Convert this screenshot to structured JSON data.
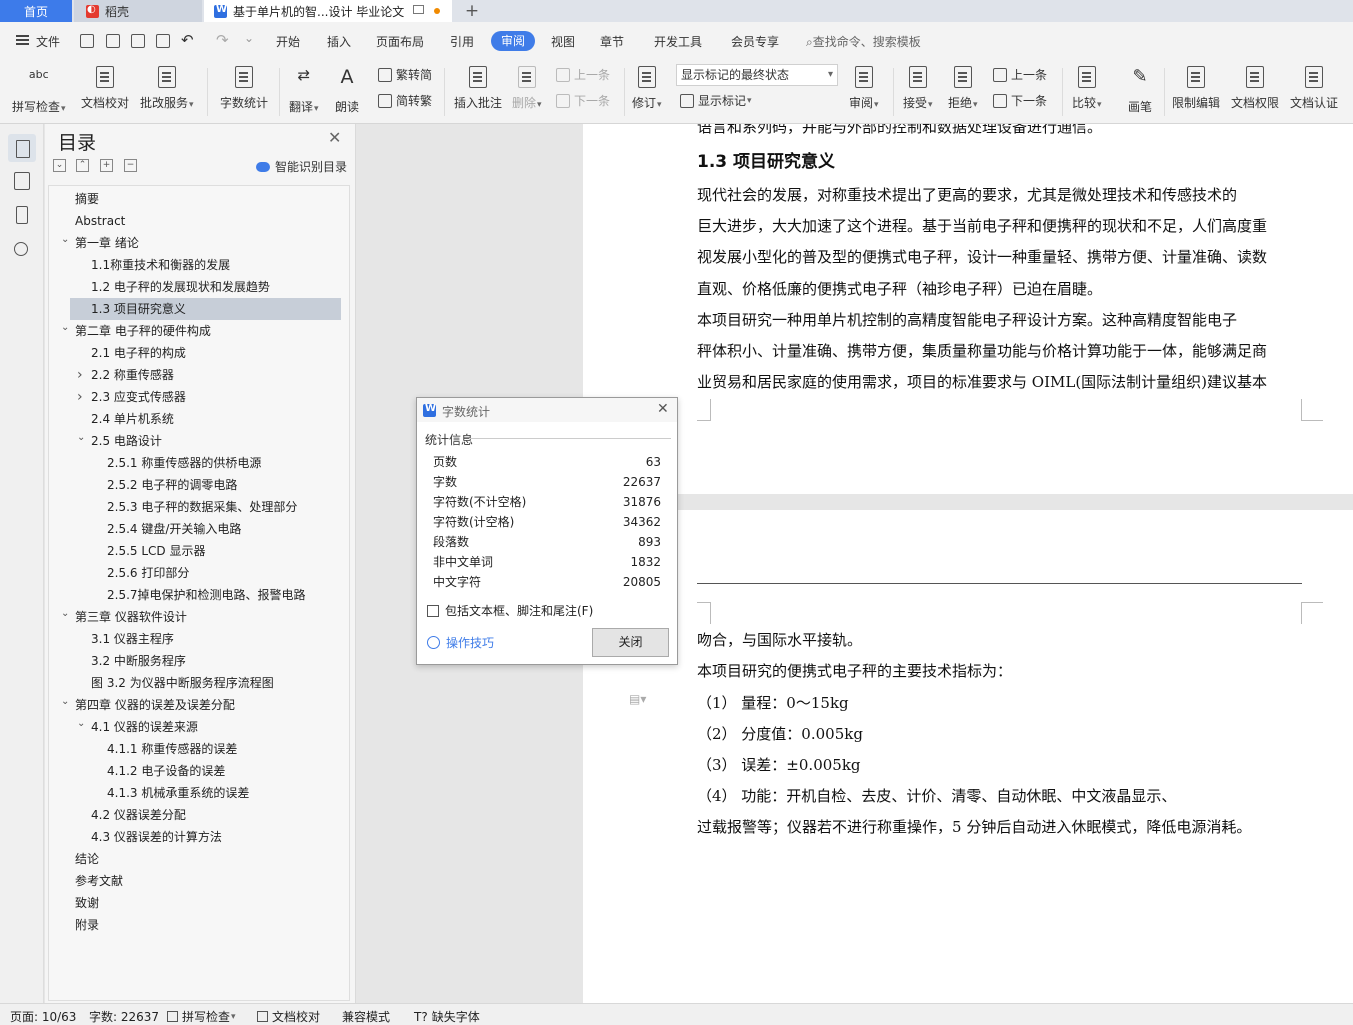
{
  "tabs": {
    "home": "首页",
    "daoke": "稻壳",
    "document": "基于单片机的智...设计 毕业论文"
  },
  "menu": {
    "file": "文件",
    "items": [
      "开始",
      "插入",
      "页面布局",
      "引用",
      "审阅",
      "视图",
      "章节",
      "开发工具",
      "会员专享"
    ],
    "search_placeholder": "查找命令、搜索模板"
  },
  "ribbon": {
    "spell_check": "拼写检查",
    "doc_proof": "文档校对",
    "annotate_service": "批改服务",
    "word_count": "字数统计",
    "translate": "翻译",
    "read_aloud": "朗读",
    "to_traditional": "繁转简",
    "to_simplified": "简转繁",
    "insert_comment": "插入批注",
    "delete": "删除",
    "prev_comment": "上一条",
    "next_comment": "下一条",
    "revise": "修订",
    "track_state": "显示标记的最终状态",
    "show_markup": "显示标记",
    "review": "审阅",
    "accept": "接受",
    "reject": "拒绝",
    "prev_change": "上一条",
    "next_change": "下一条",
    "compare": "比较",
    "pen": "画笔",
    "restrict_edit": "限制编辑",
    "doc_permission": "文档权限",
    "doc_cert": "文档认证"
  },
  "toc": {
    "title": "目录",
    "smart_toc": "智能识别目录",
    "items": [
      {
        "label": "摘要",
        "level": 1,
        "arrow": ""
      },
      {
        "label": "Abstract",
        "level": 1,
        "arrow": ""
      },
      {
        "label": "第一章  绪论",
        "level": 1,
        "arrow": "v"
      },
      {
        "label": "1.1称重技术和衡器的发展",
        "level": 2,
        "arrow": ""
      },
      {
        "label": "1.2 电子秤的发展现状和发展趋势",
        "level": 2,
        "arrow": ""
      },
      {
        "label": "1.3 项目研究意义",
        "level": 2,
        "arrow": "",
        "selected": true
      },
      {
        "label": "第二章    电子秤的硬件构成",
        "level": 1,
        "arrow": "v"
      },
      {
        "label": "2.1      电子秤的构成",
        "level": 2,
        "arrow": ""
      },
      {
        "label": "2.2    称重传感器",
        "level": 2,
        "arrow": ">"
      },
      {
        "label": "2.3    应变式传感器",
        "level": 2,
        "arrow": ">"
      },
      {
        "label": "2.4    单片机系统",
        "level": 2,
        "arrow": ""
      },
      {
        "label": "2.5    电路设计",
        "level": 2,
        "arrow": "v"
      },
      {
        "label": "2.5.1    称重传感器的供桥电源",
        "level": 3,
        "arrow": ""
      },
      {
        "label": "2.5.2    电子秤的调零电路",
        "level": 3,
        "arrow": ""
      },
      {
        "label": "2.5.3    电子秤的数据采集、处理部分",
        "level": 3,
        "arrow": ""
      },
      {
        "label": "2.5.4  键盘/开关输入电路",
        "level": 3,
        "arrow": ""
      },
      {
        "label": "2.5.5    LCD 显示器",
        "level": 3,
        "arrow": ""
      },
      {
        "label": "2.5.6  打印部分",
        "level": 3,
        "arrow": ""
      },
      {
        "label": "2.5.7掉电保护和检测电路、报警电路",
        "level": 3,
        "arrow": ""
      },
      {
        "label": "第三章    仪器软件设计",
        "level": 1,
        "arrow": "v"
      },
      {
        "label": "3.1  仪器主程序",
        "level": 2,
        "arrow": ""
      },
      {
        "label": "3.2  中断服务程序",
        "level": 2,
        "arrow": ""
      },
      {
        "label": "图 3.2 为仪器中断服务程序流程图",
        "level": 2,
        "arrow": ""
      },
      {
        "label": "第四章     仪器的误差及误差分配",
        "level": 1,
        "arrow": "v"
      },
      {
        "label": "4.1  仪器的误差来源",
        "level": 2,
        "arrow": "v"
      },
      {
        "label": "4.1.1  称重传感器的误差",
        "level": 3,
        "arrow": ""
      },
      {
        "label": "4.1.2    电子设备的误差",
        "level": 3,
        "arrow": ""
      },
      {
        "label": "4.1.3  机械承重系统的误差",
        "level": 3,
        "arrow": ""
      },
      {
        "label": "4.2    仪器误差分配",
        "level": 2,
        "arrow": ""
      },
      {
        "label": "4.3    仪器误差的计算方法",
        "level": 2,
        "arrow": ""
      },
      {
        "label": "结论",
        "level": 1,
        "arrow": ""
      },
      {
        "label": "参考文献",
        "level": 1,
        "arrow": ""
      },
      {
        "label": "致谢",
        "level": 1,
        "arrow": ""
      },
      {
        "label": "附录",
        "level": 1,
        "arrow": ""
      }
    ]
  },
  "document": {
    "cut_line": "语言和系列码，并能与外部的控制和数据处理设备进行通信。",
    "heading": "1.3 项目研究意义",
    "para1": [
      "        现代社会的发展，对称重技术提出了更高的要求，尤其是微处理技术和传感技术的",
      "巨大进步，大大加速了这个进程。基于当前电子秤和便携秤的现状和不足，人们高度重",
      "视发展小型化的普及型的便携式电子秤，设计一种重量轻、携带方便、计量准确、读数",
      "直观、价格低廉的便携式电子秤（袖珍电子秤）已迫在眉睫。"
    ],
    "para2": [
      "        本项目研究一种用单片机控制的高精度智能电子秤设计方案。这种高精度智能电子",
      "秤体积小、计量准确、携带方便，集质量称量功能与价格计算功能于一体，能够满足商",
      "业贸易和居民家庭的使用需求，项目的标准要求与 OIML(国际法制计量组织)建议基本"
    ],
    "page2": [
      "吻合，与国际水平接轨。",
      "        本项目研究的便携式电子秤的主要技术指标为：",
      "        （1）  量程：0～15kg",
      "        （2）  分度值：0.005kg",
      "        （3）  误差：±0.005kg",
      "        （4）  功能：开机自检、去皮、计价、清零、自动休眠、中文液晶显示、",
      "过载报警等；仪器若不进行称重操作，5 分钟后自动进入休眠模式，降低电源消耗。"
    ]
  },
  "dialog": {
    "title": "字数统计",
    "section": "统计信息",
    "stats": [
      {
        "label": "页数",
        "value": "63"
      },
      {
        "label": "字数",
        "value": "22637"
      },
      {
        "label": "字符数(不计空格)",
        "value": "31876"
      },
      {
        "label": "字符数(计空格)",
        "value": "34362"
      },
      {
        "label": "段落数",
        "value": "893"
      },
      {
        "label": "非中文单词",
        "value": "1832"
      },
      {
        "label": "中文字符",
        "value": "20805"
      }
    ],
    "include_label": "包括文本框、脚注和尾注(F)",
    "tips": "操作技巧",
    "close": "关闭"
  },
  "status": {
    "page": "页面: 10/63",
    "words": "字数: 22637",
    "spell": "拼写检查",
    "proof": "文档校对",
    "compat": "兼容模式",
    "missing_font": "缺失字体"
  },
  "colors": {
    "accent": "#3f7ce8",
    "selected_toc": "#c7ced8"
  }
}
